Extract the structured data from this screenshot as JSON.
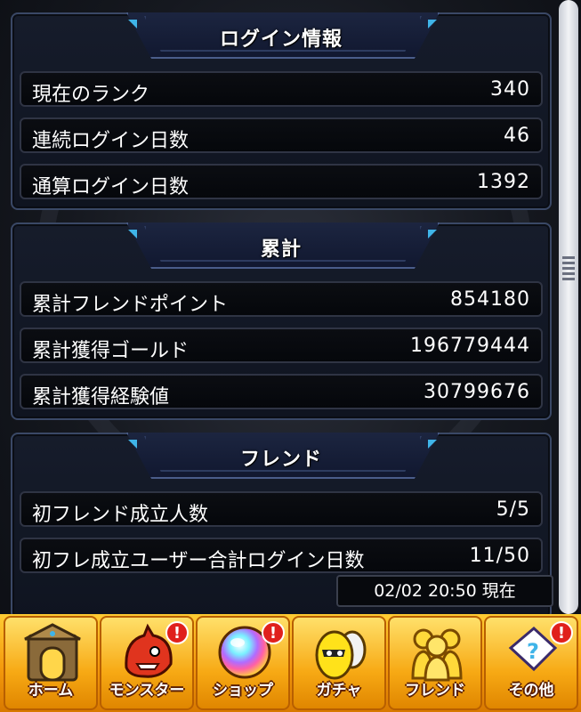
{
  "sections": {
    "login": {
      "title": "ログイン情報",
      "rows": [
        {
          "label": "現在のランク",
          "value": "340"
        },
        {
          "label": "連続ログイン日数",
          "value": "46"
        },
        {
          "label": "通算ログイン日数",
          "value": "1392"
        }
      ]
    },
    "cumulative": {
      "title": "累計",
      "rows": [
        {
          "label": "累計フレンドポイント",
          "value": "854180"
        },
        {
          "label": "累計獲得ゴールド",
          "value": "196779444"
        },
        {
          "label": "累計獲得経験値",
          "value": "30799676"
        }
      ]
    },
    "friend": {
      "title": "フレンド",
      "rows": [
        {
          "label": "初フレンド成立人数",
          "value": "5/5"
        },
        {
          "label": "初フレ成立ユーザー合計ログイン日数",
          "value": "11/50"
        }
      ]
    }
  },
  "timestamp": "02/02 20:50 現在",
  "tabbar": {
    "tabs": [
      {
        "label": "ホーム",
        "icon": "home-gate-icon",
        "badge": ""
      },
      {
        "label": "モンスター",
        "icon": "monster-icon",
        "badge": "!"
      },
      {
        "label": "ショップ",
        "icon": "rainbow-orb-icon",
        "badge": "!"
      },
      {
        "label": "ガチャ",
        "icon": "gacha-egg-icon",
        "badge": ""
      },
      {
        "label": "フレンド",
        "icon": "friends-icon",
        "badge": ""
      },
      {
        "label": "その他",
        "icon": "other-menu-icon",
        "badge": "!"
      }
    ]
  },
  "colors": {
    "accent_blue": "#3fb4e8",
    "tabbar_orange": "#f59a0c",
    "badge_red": "#e0201c"
  }
}
